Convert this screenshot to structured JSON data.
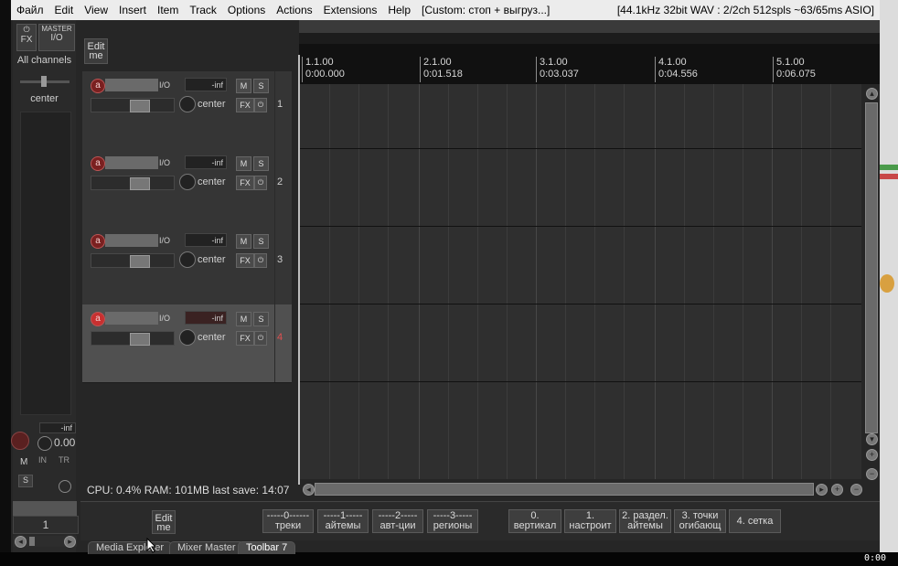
{
  "menu": [
    "Файл",
    "Edit",
    "View",
    "Insert",
    "Item",
    "Track",
    "Options",
    "Actions",
    "Extensions",
    "Help"
  ],
  "title_custom": "[Custom: стоп + выгруз...]",
  "audio_status": "[44.1kHz 32bit WAV : 2/2ch 512spls ~63/65ms ASIO]",
  "master": {
    "power_icon": "⏻",
    "fx": "FX",
    "master_label": "MASTER",
    "io": "I/O",
    "all_channels": "All channels",
    "center": "center",
    "inf": "-inf",
    "volume": "0.00",
    "m": "M",
    "s": "S",
    "in": "IN",
    "tr": "TR",
    "counter": "1"
  },
  "edit_me": [
    "Edit",
    "me"
  ],
  "ruler": [
    {
      "bar": "1.1.00",
      "time": "0:00.000"
    },
    {
      "bar": "2.1.00",
      "time": "0:01.518"
    },
    {
      "bar": "3.1.00",
      "time": "0:03.037"
    },
    {
      "bar": "4.1.00",
      "time": "0:04.556"
    },
    {
      "bar": "5.1.00",
      "time": "0:06.075"
    }
  ],
  "tracks": [
    {
      "number": "1",
      "io": "I/O",
      "meter": "-inf",
      "m": "M",
      "s": "S",
      "fx": "FX",
      "pan": "center",
      "rec": "a",
      "selected": false
    },
    {
      "number": "2",
      "io": "I/O",
      "meter": "-inf",
      "m": "M",
      "s": "S",
      "fx": "FX",
      "pan": "center",
      "rec": "a",
      "selected": false
    },
    {
      "number": "3",
      "io": "I/O",
      "meter": "-inf",
      "m": "M",
      "s": "S",
      "fx": "FX",
      "pan": "center",
      "rec": "a",
      "selected": false
    },
    {
      "number": "4",
      "io": "I/O",
      "meter": "-inf",
      "m": "M",
      "s": "S",
      "fx": "FX",
      "pan": "center",
      "rec": "a",
      "selected": true
    }
  ],
  "status": "CPU: 0.4%  RAM: 101MB  last save: 14:07",
  "toolbar_buttons": [
    [
      "-----0------",
      "треки"
    ],
    [
      "-----1-----",
      "айтемы"
    ],
    [
      "-----2-----",
      "авт-ции"
    ],
    [
      "-----3-----",
      "регионы"
    ],
    [
      "0.",
      "вертикал"
    ],
    [
      "1.",
      "настроит"
    ],
    [
      "2. раздел.",
      "айтемы"
    ],
    [
      "3. точки",
      "огибающ"
    ],
    [
      "4. сетка"
    ]
  ],
  "tabs": [
    "Media Explorer",
    "Mixer Master",
    "Toolbar 7"
  ],
  "timecode": "0:00"
}
